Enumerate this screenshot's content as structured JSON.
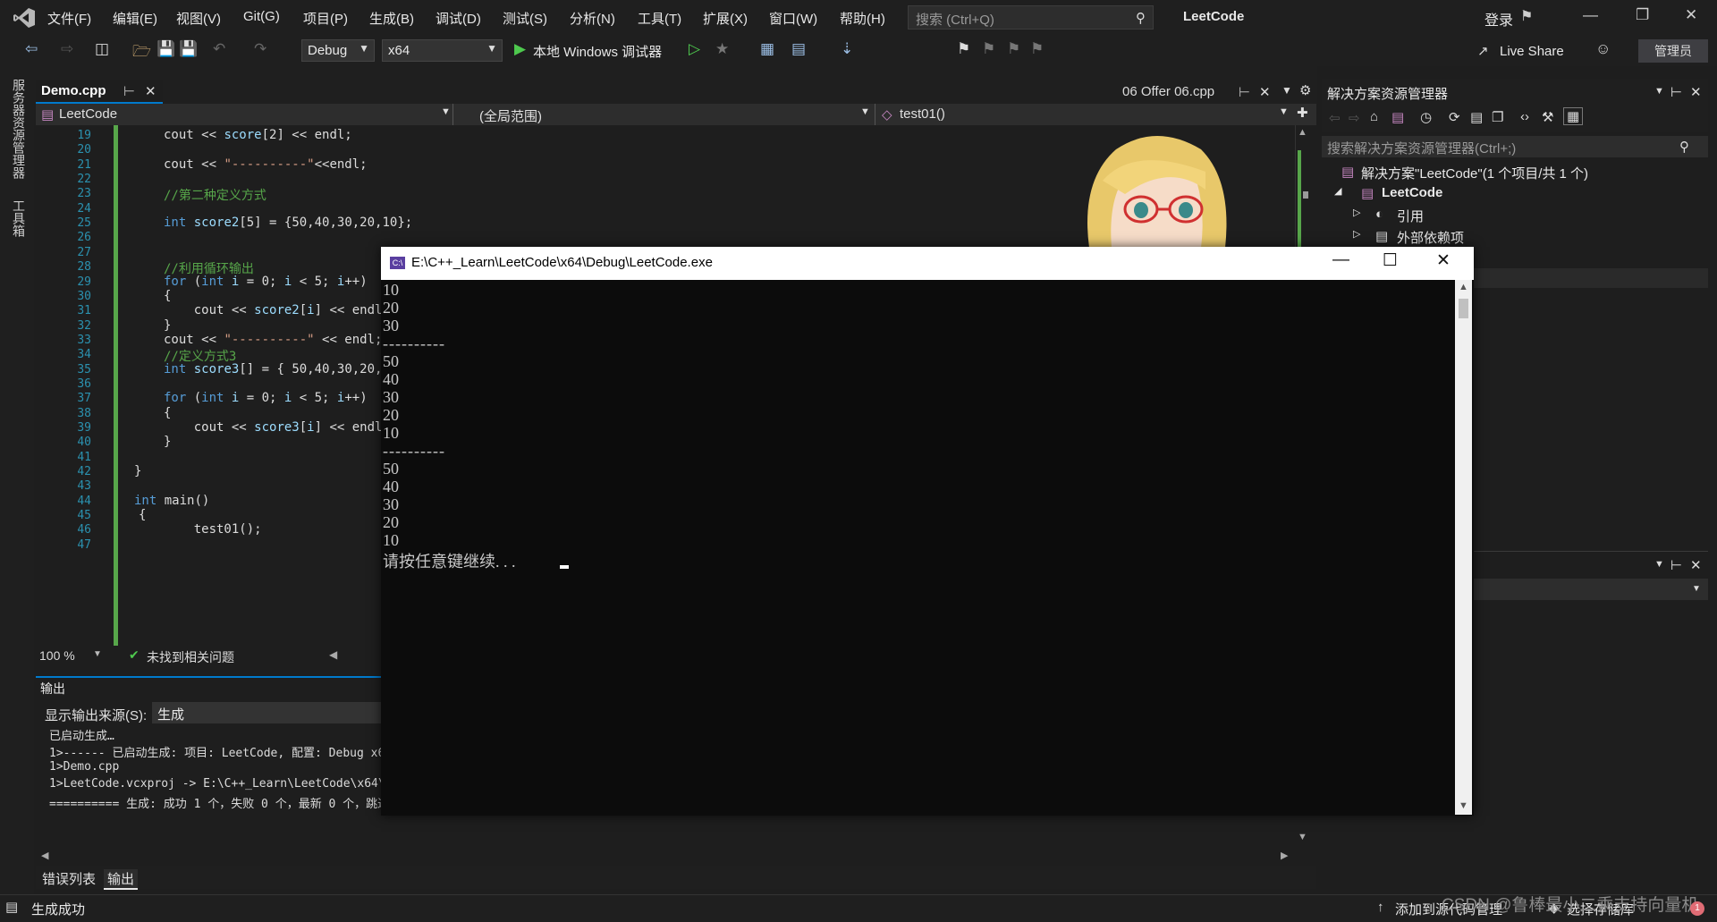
{
  "menu": [
    "文件(F)",
    "编辑(E)",
    "视图(V)",
    "Git(G)",
    "项目(P)",
    "生成(B)",
    "调试(D)",
    "测试(S)",
    "分析(N)",
    "工具(T)",
    "扩展(X)",
    "窗口(W)",
    "帮助(H)"
  ],
  "search": {
    "placeholder": "搜索 (Ctrl+Q)"
  },
  "app_title": "LeetCode",
  "signin": "登录",
  "toolbar": {
    "config": "Debug",
    "platform": "x64",
    "run_label": "本地 Windows 调试器",
    "live_share": "Live Share",
    "admin": "管理员"
  },
  "left_strip": [
    "服务器资源管理器",
    "工具箱"
  ],
  "editor": {
    "tab_active": "Demo.cpp",
    "tab_other": "06 Offer 06.cpp",
    "nav_project": "LeetCode",
    "nav_scope": "(全局范围)",
    "nav_function": "test01()",
    "zoom": "100 %",
    "issues": "未找到相关问题",
    "lines": [
      {
        "n": "19",
        "code": "cout << score[2] << endl;"
      },
      {
        "n": "20",
        "code": ""
      },
      {
        "n": "21",
        "code": "cout << \"----------\"<<endl;"
      },
      {
        "n": "22",
        "code": ""
      },
      {
        "n": "23",
        "code": "//第二种定义方式"
      },
      {
        "n": "24",
        "code": ""
      },
      {
        "n": "25",
        "code": "int score2[5] = {50,40,30,20,10};"
      },
      {
        "n": "26",
        "code": ""
      },
      {
        "n": "27",
        "code": ""
      },
      {
        "n": "28",
        "code": "//利用循环输出"
      },
      {
        "n": "29",
        "code": "for (int i = 0; i < 5; i++)"
      },
      {
        "n": "30",
        "code": "{"
      },
      {
        "n": "31",
        "code": "    cout << score2[i] << endl;"
      },
      {
        "n": "32",
        "code": "}"
      },
      {
        "n": "33",
        "code": "cout << \"----------\" << endl;"
      },
      {
        "n": "34",
        "code": "//定义方式3"
      },
      {
        "n": "35",
        "code": "int score3[] = { 50,40,30,20,10 };"
      },
      {
        "n": "36",
        "code": ""
      },
      {
        "n": "37",
        "code": "for (int i = 0; i < 5; i++)"
      },
      {
        "n": "38",
        "code": "{"
      },
      {
        "n": "39",
        "code": "    cout << score3[i] << endl;"
      },
      {
        "n": "40",
        "code": "}"
      },
      {
        "n": "41",
        "code": ""
      },
      {
        "n": "42",
        "code": "}"
      },
      {
        "n": "43",
        "code": ""
      },
      {
        "n": "44",
        "code": "int main()"
      },
      {
        "n": "45",
        "code": "{"
      },
      {
        "n": "46",
        "code": "    test01();"
      },
      {
        "n": "47",
        "code": ""
      }
    ]
  },
  "output": {
    "title": "输出",
    "source_label": "显示输出来源(S):",
    "source_value": "生成",
    "lines": [
      "已启动生成…",
      "1>------ 已启动生成: 项目: LeetCode, 配置: Debug x64 ------",
      "1>Demo.cpp",
      "1>LeetCode.vcxproj -> E:\\C++_Learn\\LeetCode\\x64\\Debug\\LeetCode.exe",
      "========== 生成: 成功 1 个，失败 0 个，最新 0 个，跳过 0 个 =========="
    ]
  },
  "bottom_tabs": [
    "错误列表",
    "输出"
  ],
  "solution_explorer": {
    "title": "解决方案资源管理器",
    "search_placeholder": "搜索解决方案资源管理器(Ctrl+;)",
    "solution": "解决方案\"LeetCode\"(1 个项目/共 1 个)",
    "project": "LeetCode",
    "references": "引用",
    "external_deps": "外部依赖项"
  },
  "console": {
    "title": "E:\\C++_Learn\\LeetCode\\x64\\Debug\\LeetCode.exe",
    "lines": [
      "10",
      "20",
      "30",
      "----------",
      "50",
      "40",
      "30",
      "20",
      "10",
      "----------",
      "50",
      "40",
      "30",
      "20",
      "10",
      "请按任意键继续. . . "
    ]
  },
  "status": {
    "left": "生成成功",
    "add_source": "添加到源代码管理",
    "select_repo": "选择存储库"
  },
  "watermark": "CSDN @鲁棒最小二乘支持向量机",
  "colors": {
    "accent": "#007acc",
    "keyword": "#569cd6",
    "comment": "#57a64a",
    "console_bg": "#0c0c0c"
  }
}
